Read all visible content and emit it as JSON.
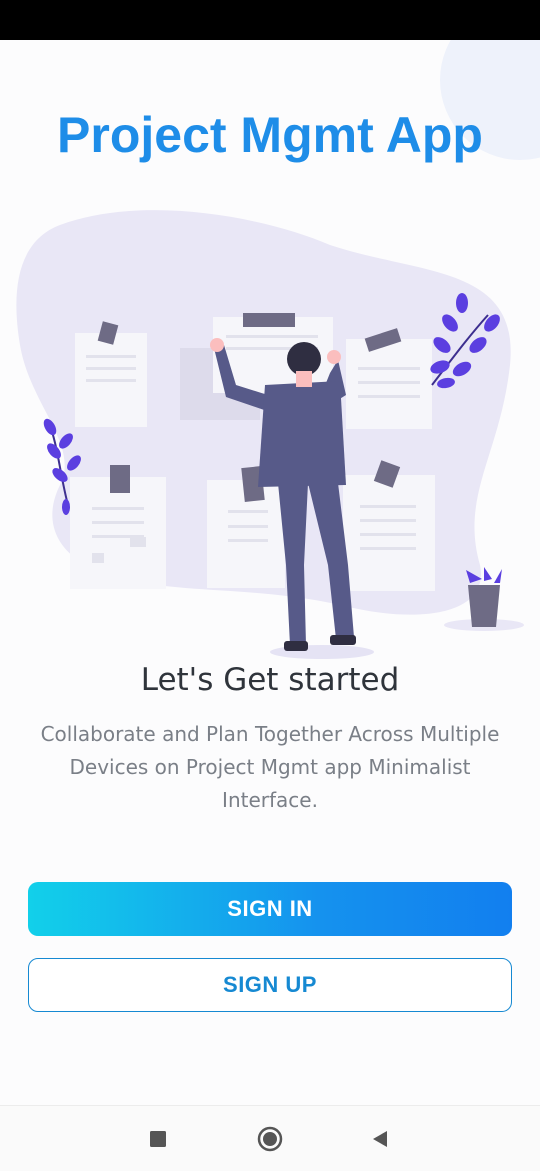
{
  "app": {
    "title": "Project Mgmt App"
  },
  "onboarding": {
    "headline": "Let's Get started",
    "subtitle": "Collaborate and Plan Together Across Multiple Devices on Project Mgmt app Minimalist Interface."
  },
  "actions": {
    "sign_in_label": "SIGN IN",
    "sign_up_label": "SIGN UP"
  },
  "navigation": {
    "buttons": [
      "recents-square-icon",
      "home-circle-icon",
      "back-triangle-icon"
    ]
  },
  "colors": {
    "accent": "#1e8de8",
    "gradient_start": "#12d0ea",
    "gradient_end": "#127fef",
    "figure": "#575a89",
    "plant": "#5b3fe0"
  }
}
